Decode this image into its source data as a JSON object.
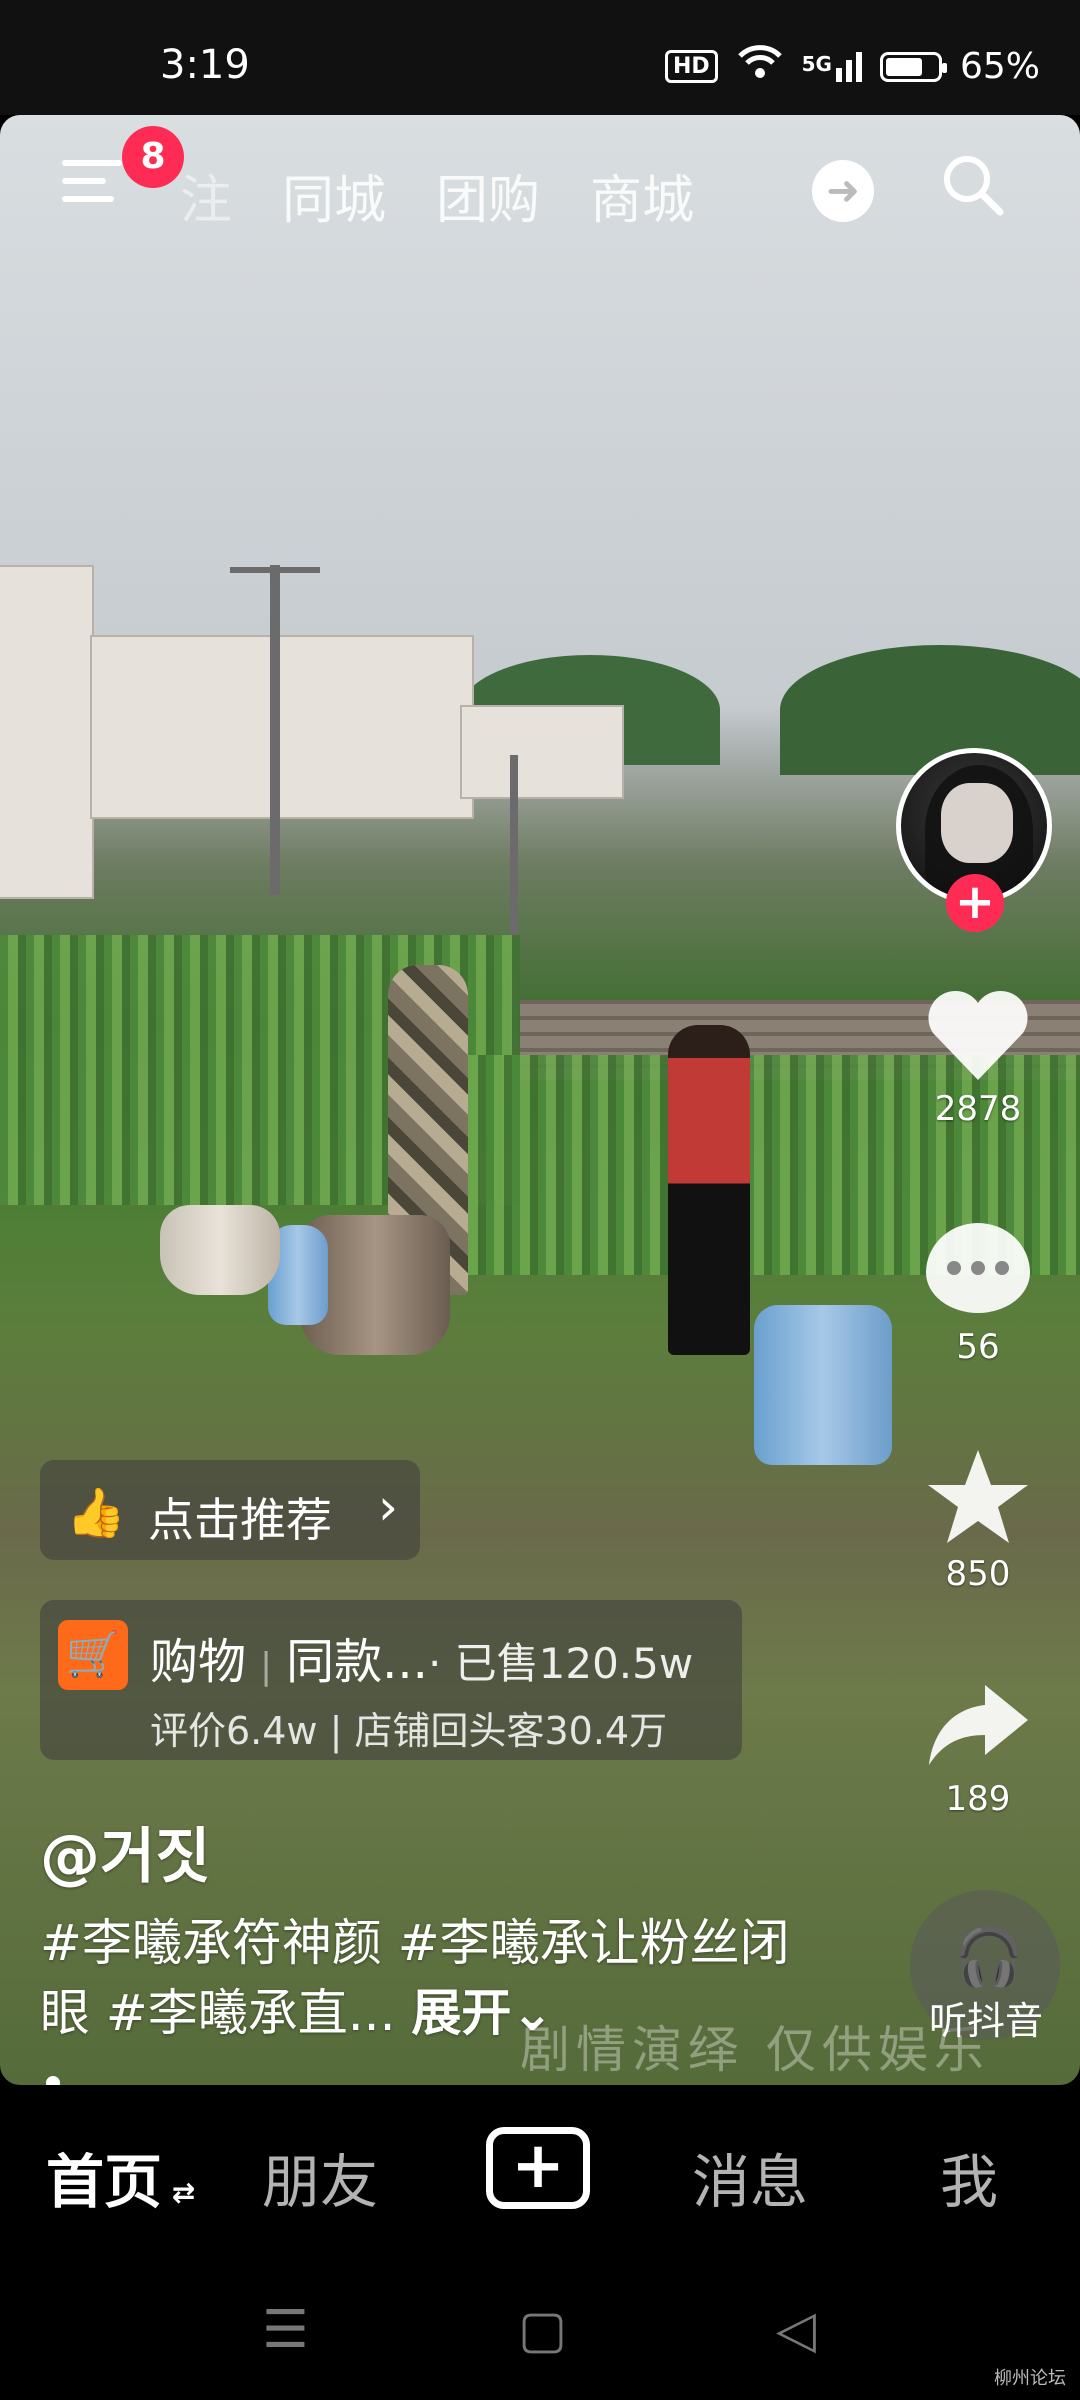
{
  "status_bar": {
    "time": "3:19",
    "hd": "HD",
    "network": "5G",
    "battery": "65%",
    "battery_level": 0.65
  },
  "top_nav": {
    "notification_badge": "8",
    "tabs": [
      "注",
      "同城",
      "团购",
      "商城"
    ]
  },
  "side_actions": {
    "follow_symbol": "+",
    "likes": "2878",
    "comments": "56",
    "favorites": "850",
    "shares": "189"
  },
  "recommend": {
    "label": "点击推荐"
  },
  "shop": {
    "label": "购物",
    "title": "同款...",
    "sold": "· 已售120.5w",
    "rating": "评价6.4w",
    "repeat_customers": "店铺回头客30.4万"
  },
  "video": {
    "author": "@거짓",
    "caption": "#李曦承符神颜 #李曦承让粉丝闭眼 #李曦承直...",
    "expand": "展开",
    "watermark": "剧情演绎 仅供娱乐"
  },
  "music": {
    "label": "听抖音"
  },
  "bottom_nav": {
    "home": "首页",
    "friends": "朋友",
    "messages": "消息",
    "me": "我"
  },
  "footer": {
    "forum": "柳州论坛"
  }
}
